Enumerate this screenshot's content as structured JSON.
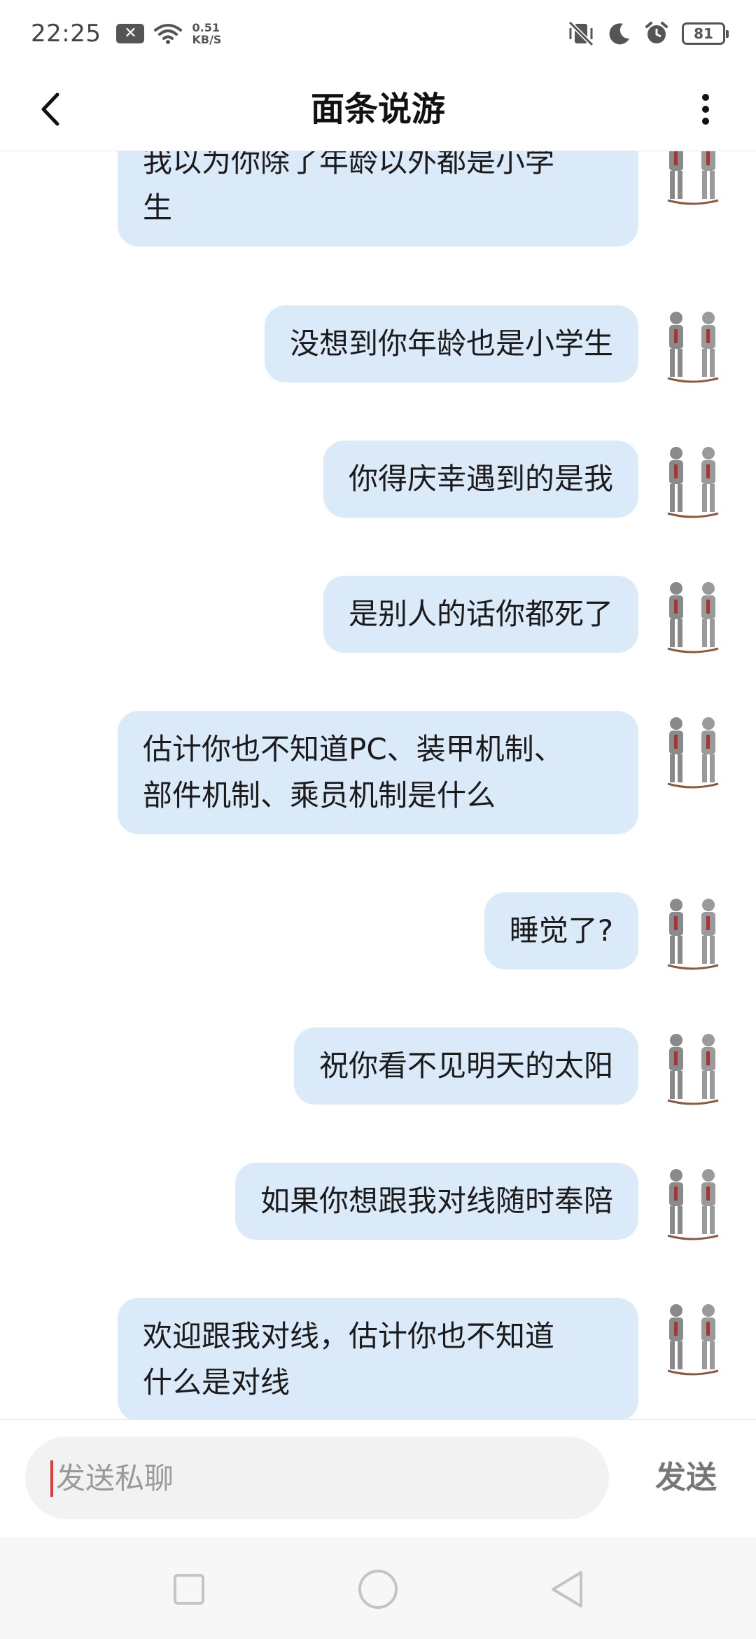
{
  "status_bar": {
    "time": "22:25",
    "net_speed_value": "0.51",
    "net_speed_unit": "KB/S",
    "battery": "81",
    "icons": [
      "notification-icon",
      "wifi-icon",
      "vibrate-off-icon",
      "do-not-disturb-moon-icon",
      "alarm-icon",
      "battery-icon"
    ]
  },
  "header": {
    "title": "面条说游"
  },
  "messages": [
    {
      "text": "我以为你除了年龄以外都是小学\n生"
    },
    {
      "text": "没想到你年龄也是小学生"
    },
    {
      "text": "你得庆幸遇到的是我"
    },
    {
      "text": "是别人的话你都死了"
    },
    {
      "text": "估计你也不知道PC、装甲机制、\n部件机制、乘员机制是什么"
    },
    {
      "text": "睡觉了?"
    },
    {
      "text": "祝你看不见明天的太阳"
    },
    {
      "text": "如果你想跟我对线随时奉陪"
    },
    {
      "text": "欢迎跟我对线，估计你也不知道\n什么是对线"
    }
  ],
  "composer": {
    "placeholder": "发送私聊",
    "value": "",
    "send_label": "发送"
  },
  "colors": {
    "bubble": "#daeaf9",
    "caret": "#e53935",
    "send": "#777777"
  }
}
